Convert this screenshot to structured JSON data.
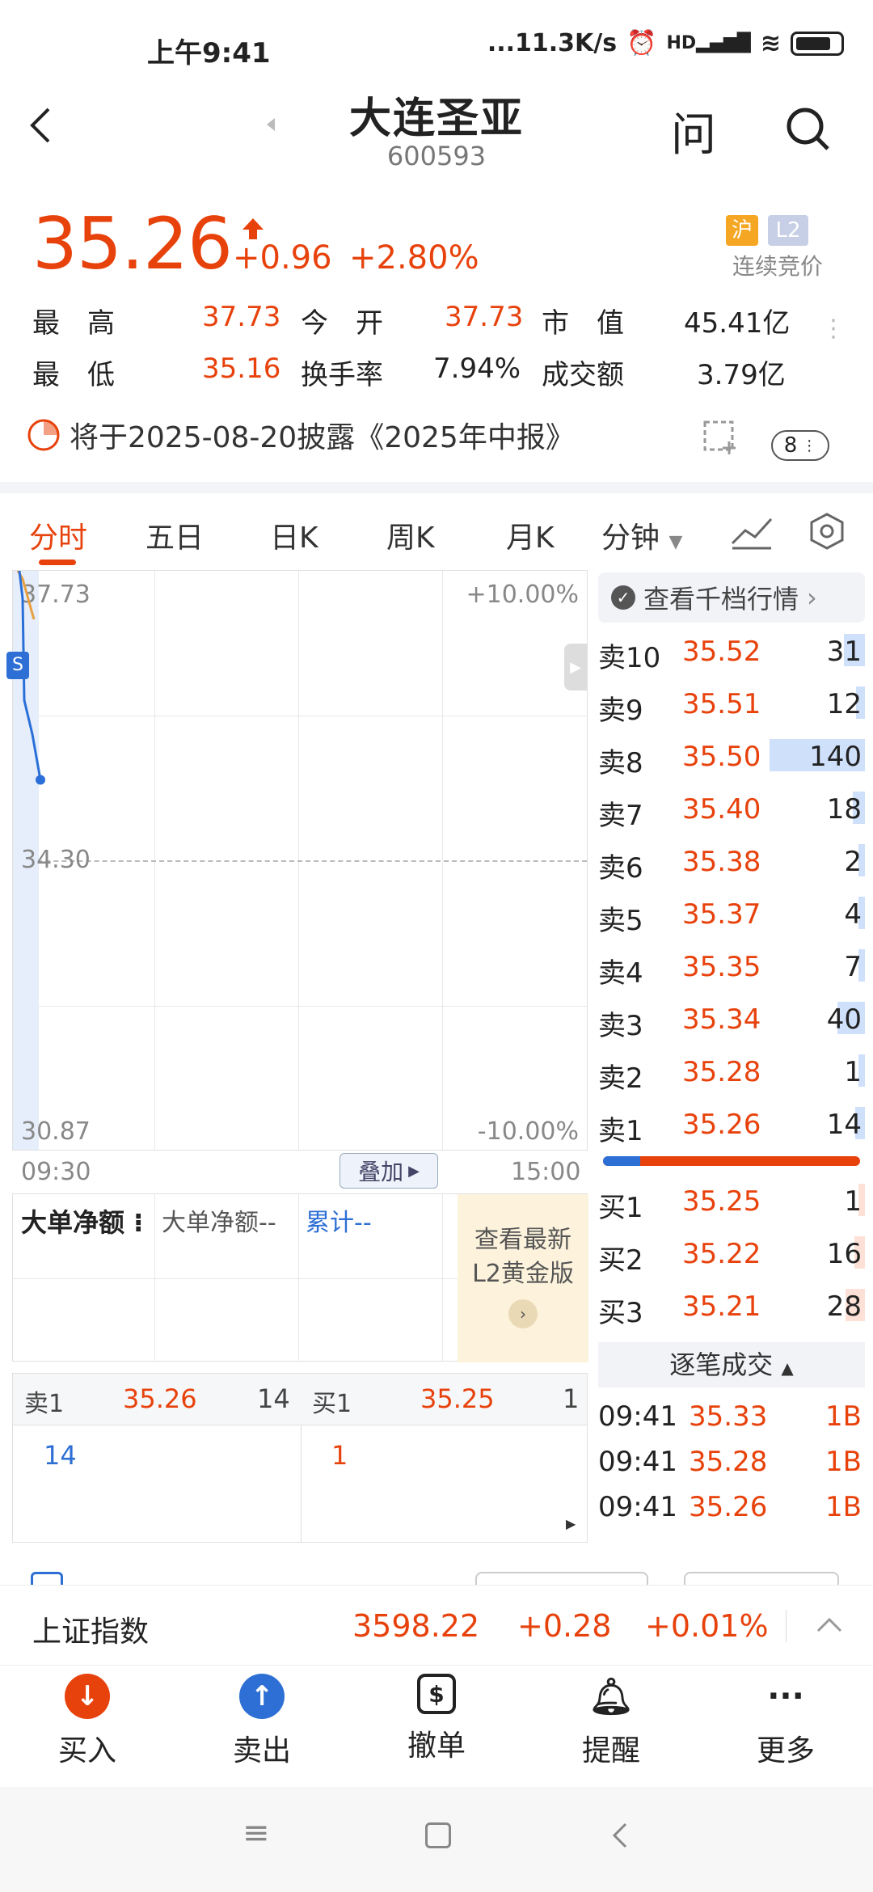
{
  "status": {
    "time": "上午9:41",
    "net": "...11.3K/s",
    "signal": "HD"
  },
  "header": {
    "title": "大连圣亚",
    "code": "600593",
    "ask_label": "问"
  },
  "quote": {
    "price": "35.26",
    "change": "+0.96",
    "change_pct": "+2.80%",
    "exchange_badge": "沪",
    "level_badge": "L2",
    "session": "连续竞价",
    "high_label": "最　高",
    "high": "37.73",
    "open_label": "今　开",
    "open": "37.73",
    "mktcap_label": "市　值",
    "mktcap": "45.41亿",
    "low_label": "最　低",
    "low": "35.16",
    "turnover_label": "换手率",
    "turnover": "7.94%",
    "amount_label": "成交额",
    "amount": "3.79亿"
  },
  "notice": {
    "text": "将于2025-08-20披露《2025年中报》",
    "badge": "8"
  },
  "tabs": [
    "分时",
    "五日",
    "日K",
    "周K",
    "月K",
    "分钟"
  ],
  "chart": {
    "top_price": "37.73",
    "mid_price": "34.30",
    "bottom_price": "30.87",
    "top_pct": "+10.00%",
    "bottom_pct": "-10.00%",
    "start_time": "09:30",
    "end_time": "15:00",
    "overlay_label": "叠加",
    "s_marker": "S"
  },
  "chart_data": {
    "type": "line",
    "x": [
      "09:30",
      "09:30",
      "09:31",
      "09:32",
      "09:33"
    ],
    "y": [
      37.73,
      37.4,
      36.2,
      35.8,
      35.26
    ],
    "ylim": [
      30.87,
      37.73
    ],
    "series": [
      {
        "values": [
          37.73,
          37.4,
          36.2,
          35.8,
          35.26
        ]
      }
    ]
  },
  "bigorder": {
    "title": "大单净额",
    "value_label": "大单净额--",
    "cumulative": "累计--",
    "promo": "查看最新L2黄金版"
  },
  "mini_book": {
    "sell_label": "卖1",
    "sell_price": "35.26",
    "sell_qty": "14",
    "sell_detail": "14",
    "buy_label": "买1",
    "buy_price": "35.25",
    "buy_qty": "1",
    "buy_detail": "1"
  },
  "orderbook": {
    "header": "查看千档行情",
    "asks": [
      {
        "label": "卖10",
        "price": "35.52",
        "qty": "31",
        "fill": 0.22
      },
      {
        "label": "卖9",
        "price": "35.51",
        "qty": "12",
        "fill": 0.09
      },
      {
        "label": "卖8",
        "price": "35.50",
        "qty": "140",
        "fill": 1.0
      },
      {
        "label": "卖7",
        "price": "35.40",
        "qty": "18",
        "fill": 0.13
      },
      {
        "label": "卖6",
        "price": "35.38",
        "qty": "2",
        "fill": 0.02
      },
      {
        "label": "卖5",
        "price": "35.37",
        "qty": "4",
        "fill": 0.03
      },
      {
        "label": "卖4",
        "price": "35.35",
        "qty": "7",
        "fill": 0.05
      },
      {
        "label": "卖3",
        "price": "35.34",
        "qty": "40",
        "fill": 0.29
      },
      {
        "label": "卖2",
        "price": "35.28",
        "qty": "1",
        "fill": 0.01
      },
      {
        "label": "卖1",
        "price": "35.26",
        "qty": "14",
        "fill": 0.1
      }
    ],
    "bids": [
      {
        "label": "买1",
        "price": "35.25",
        "qty": "1",
        "fill": 0.01
      },
      {
        "label": "买2",
        "price": "35.22",
        "qty": "16",
        "fill": 0.11
      },
      {
        "label": "买3",
        "price": "35.21",
        "qty": "28",
        "fill": 0.2
      }
    ],
    "trades_title": "逐笔成交",
    "trades": [
      {
        "time": "09:41",
        "price": "35.33",
        "vol": "1B"
      },
      {
        "time": "09:41",
        "price": "35.28",
        "vol": "1B"
      },
      {
        "time": "09:41",
        "price": "35.26",
        "vol": "1B"
      }
    ]
  },
  "index_bar": {
    "name": "上证指数",
    "value": "3598.22",
    "change": "+0.28",
    "pct": "+0.01%"
  },
  "bottom_nav": [
    "买入",
    "卖出",
    "撤单",
    "提醒",
    "更多"
  ],
  "colors": {
    "up": "#e8420c",
    "down": "#2d6fd4",
    "line": "#2a6fd8"
  }
}
